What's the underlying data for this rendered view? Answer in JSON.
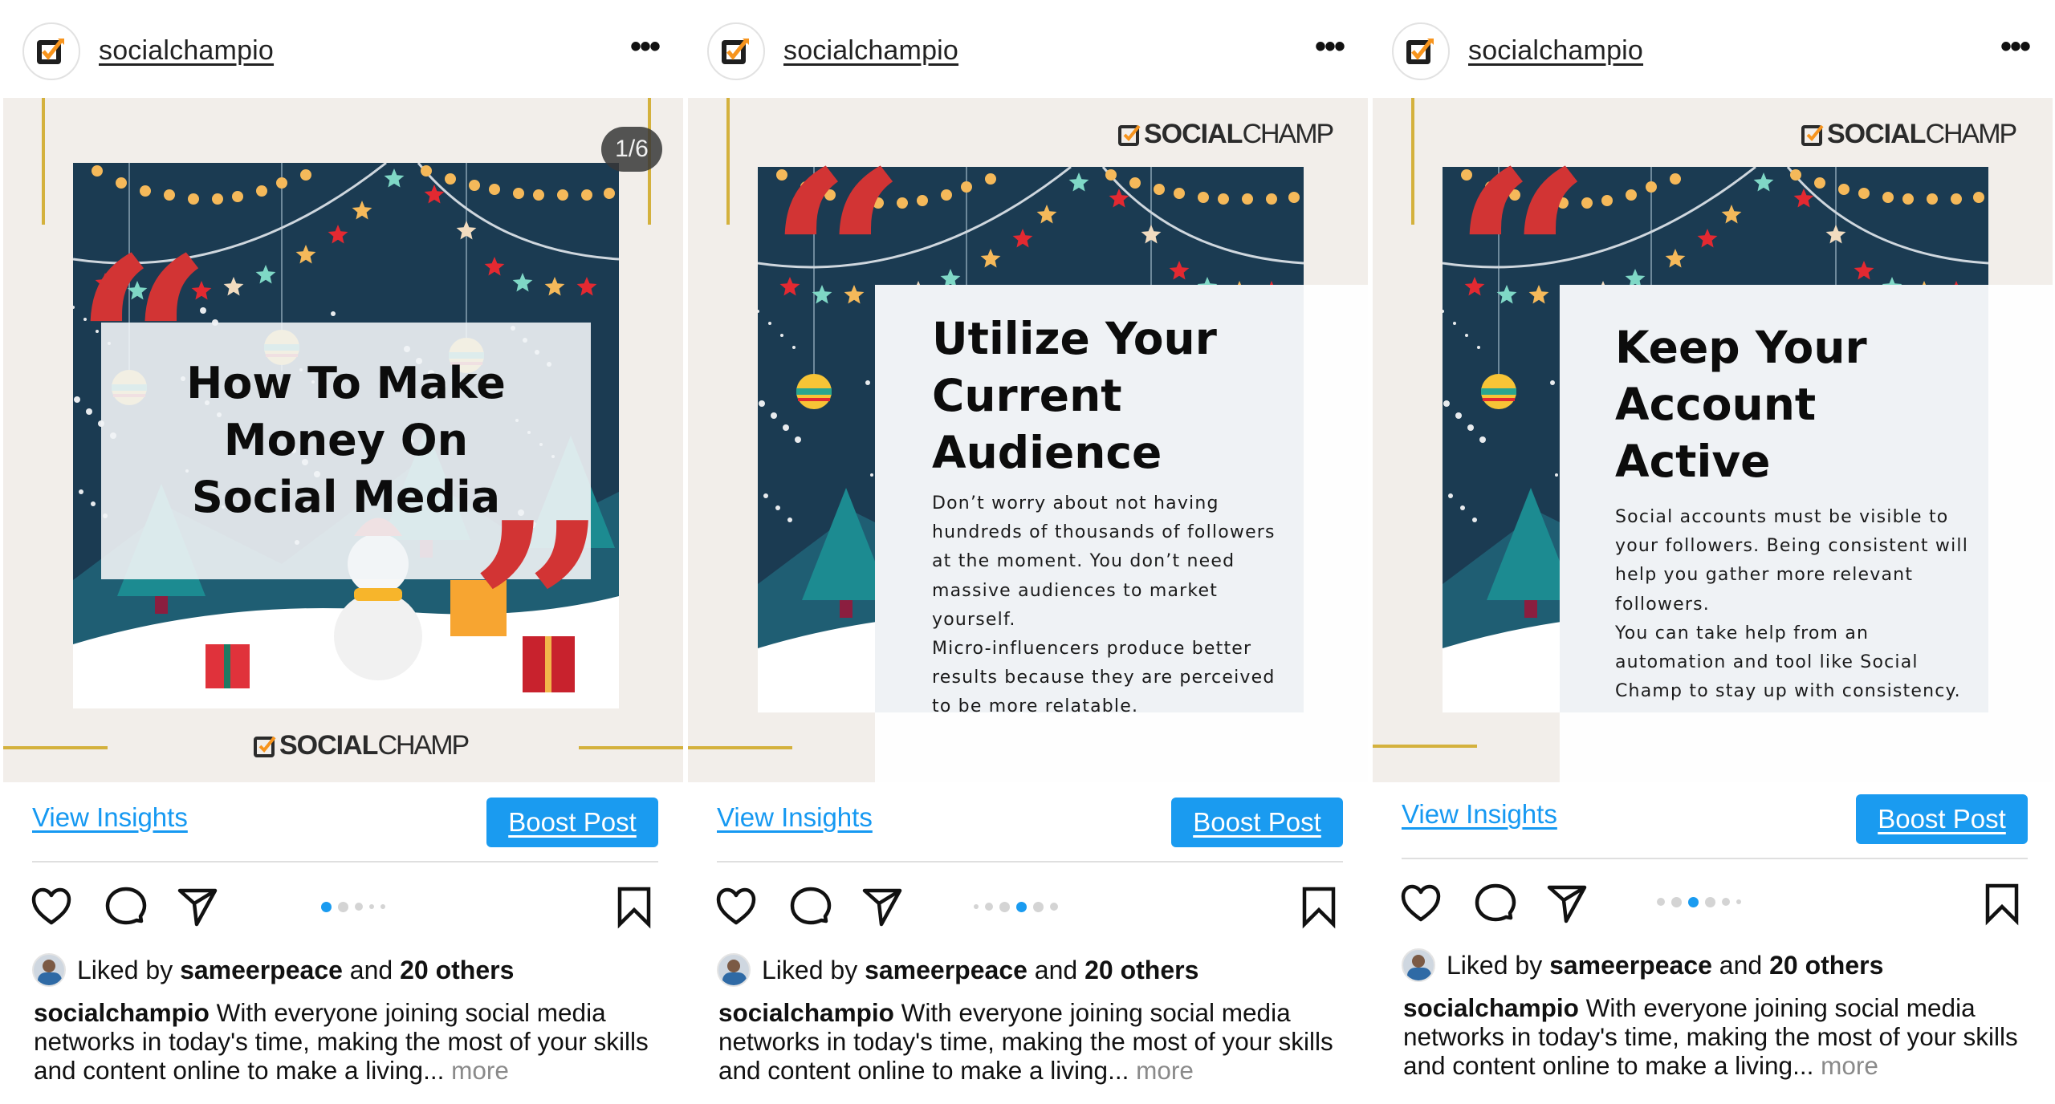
{
  "posts": [
    {
      "account": {
        "username": "socialchampio",
        "avatar_icon": "socialchamp-checkbox-logo",
        "more_icon": "more-horizontal-icon"
      },
      "slide": {
        "counter": "1/6",
        "brand": {
          "bold": "SOCIAL",
          "light": "CHAMP"
        },
        "title_lines": [
          "How To Make",
          "Money On",
          "Social Media"
        ],
        "body_lines": [],
        "open_quote": "“",
        "close_quote": "”"
      },
      "actions": {
        "insights_label": "View Insights",
        "boost_label": "Boost Post"
      },
      "carousel": {
        "total_visible_dots": 5,
        "active_index": 0
      },
      "likes": {
        "prefix": "Liked by",
        "user": "sameerpeace",
        "conjunction": "and",
        "others": "20 others"
      },
      "caption": {
        "author": "socialchampio",
        "text": "With everyone joining social media networks in today's time, making the most of your skills and content online to make a living...",
        "more_label": "more"
      }
    },
    {
      "account": {
        "username": "socialchampio",
        "avatar_icon": "socialchamp-checkbox-logo",
        "more_icon": "more-horizontal-icon"
      },
      "slide": {
        "counter": "",
        "brand": {
          "bold": "SOCIAL",
          "light": "CHAMP"
        },
        "title_lines": [
          "Utilize Your",
          "Current",
          "Audience"
        ],
        "body_lines": [
          "Don’t worry about not having",
          "hundreds of thousands of followers",
          "at the moment. You don’t need",
          "massive audiences to market",
          "yourself.",
          "Micro-influencers produce better",
          "results because they are perceived",
          "to be more relatable."
        ],
        "open_quote": "“",
        "close_quote": ""
      },
      "actions": {
        "insights_label": "View Insights",
        "boost_label": "Boost Post"
      },
      "carousel": {
        "total_visible_dots": 6,
        "active_index": 3
      },
      "likes": {
        "prefix": "Liked by",
        "user": "sameerpeace",
        "conjunction": "and",
        "others": "20 others"
      },
      "caption": {
        "author": "socialchampio",
        "text": "With everyone joining social media networks in today's time, making the most of your skills and content online to make a living...",
        "more_label": "more"
      }
    },
    {
      "account": {
        "username": "socialchampio",
        "avatar_icon": "socialchamp-checkbox-logo",
        "more_icon": "more-horizontal-icon"
      },
      "slide": {
        "counter": "",
        "brand": {
          "bold": "SOCIAL",
          "light": "CHAMP"
        },
        "title_lines": [
          "Keep Your",
          "Account",
          "Active"
        ],
        "body_lines": [
          "Social accounts must be visible to",
          "your followers. Being consistent will",
          "help you gather more relevant",
          "followers.",
          "You can take help from an",
          "automation and tool like Social",
          "Champ to stay up with consistency."
        ],
        "open_quote": "“",
        "close_quote": ""
      },
      "actions": {
        "insights_label": "View Insights",
        "boost_label": "Boost Post"
      },
      "carousel": {
        "total_visible_dots": 6,
        "active_index": 2
      },
      "likes": {
        "prefix": "Liked by",
        "user": "sameerpeace",
        "conjunction": "and",
        "others": "20 others"
      },
      "caption": {
        "author": "socialchampio",
        "text": "With everyone joining social media networks in today's time, making the most of your skills and content online to make a living...",
        "more_label": "more"
      }
    }
  ],
  "colors": {
    "accent_blue": "#1a9bf0",
    "quote_red": "#d23434",
    "gold": "#d4b13d",
    "slide_bg": "#f2eeea",
    "night_sky": "#1b3b52",
    "logo_orange": "#f7941d"
  }
}
